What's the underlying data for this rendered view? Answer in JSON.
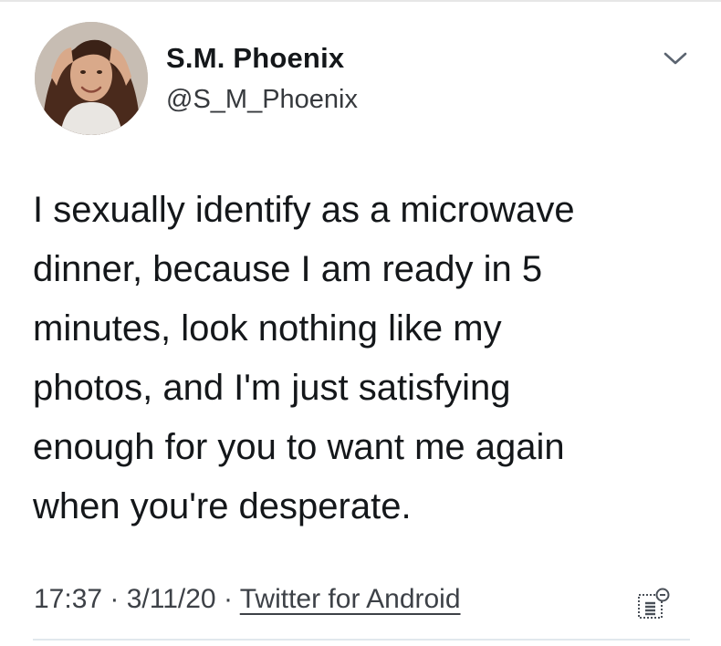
{
  "tweet": {
    "author": {
      "display_name": "S.M. Phoenix",
      "handle": "@S_M_Phoenix",
      "avatar_icon": "profile-photo"
    },
    "text_lines": [
      "I sexually identify as a microwave",
      "dinner, because I am ready in 5",
      "minutes, look nothing like my",
      "photos, and I'm just satisfying",
      "enough for you to want me again",
      "when you're desperate."
    ],
    "meta": {
      "time": "17:37",
      "separator": " · ",
      "date": "3/11/20",
      "source": "Twitter for Android"
    },
    "icons": {
      "menu": "chevron-down-icon",
      "analytics": "analytics-icon"
    }
  },
  "colors": {
    "text": "#14171a",
    "secondary": "#3d4147",
    "divider": "#e1e8ed"
  }
}
